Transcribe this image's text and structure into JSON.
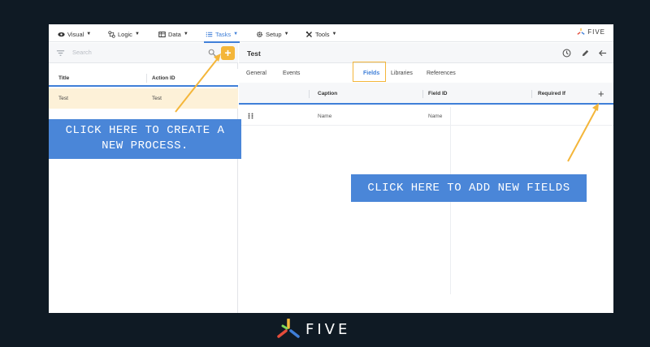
{
  "menu": {
    "items": [
      {
        "label": "Visual",
        "icon": "eye-icon"
      },
      {
        "label": "Logic",
        "icon": "logic-icon"
      },
      {
        "label": "Data",
        "icon": "table-icon"
      },
      {
        "label": "Tasks",
        "icon": "tasks-icon",
        "active": true
      },
      {
        "label": "Setup",
        "icon": "gear-icon"
      },
      {
        "label": "Tools",
        "icon": "tools-icon"
      }
    ],
    "brand": "FIVE"
  },
  "left": {
    "search_placeholder": "Search",
    "add_label": "+",
    "columns": [
      "Title",
      "Action ID"
    ],
    "rows": [
      {
        "title": "Test",
        "action_id": "Test"
      }
    ]
  },
  "right": {
    "title": "Test",
    "tabs": [
      "General",
      "Events",
      "Fields",
      "Libraries",
      "References"
    ],
    "active_tab": "Fields",
    "columns": [
      "Caption",
      "Field ID",
      "Required If"
    ],
    "add_label": "+",
    "rows": [
      {
        "caption": "Name",
        "field_id": "Name"
      }
    ]
  },
  "callouts": {
    "create_line1": "CLICK HERE TO CREATE A",
    "create_line2": "NEW PROCESS.",
    "add_fields": "CLICK HERE TO ADD NEW FIELDS"
  },
  "footer": {
    "brand": "FIVE"
  },
  "colors": {
    "accent": "#3f7fd8",
    "highlight": "#f4b63a",
    "callout": "#4a86d8",
    "background": "#0f1a24",
    "row_selected": "#fdf1d8"
  }
}
